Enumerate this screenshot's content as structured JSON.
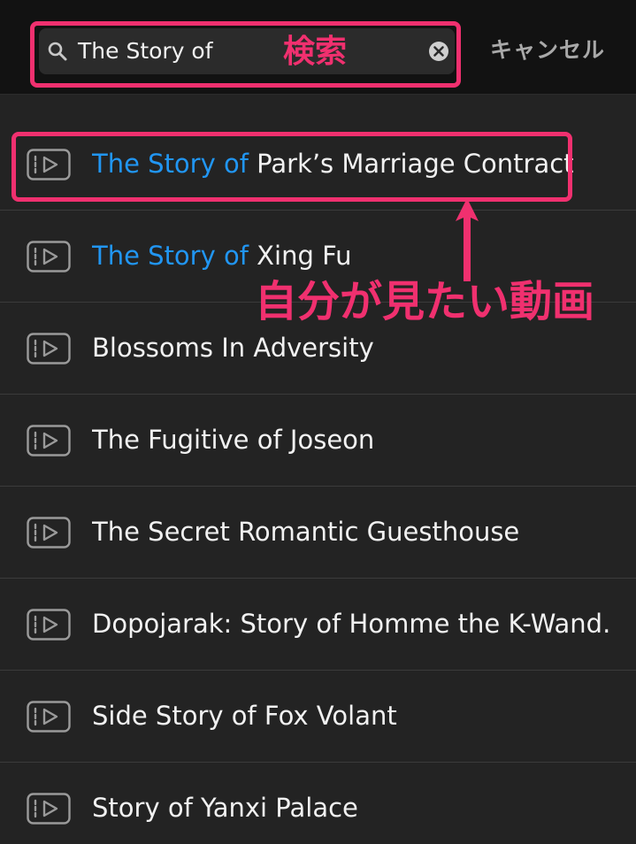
{
  "search": {
    "query": "The Story of",
    "cancel_label": "キャンセル"
  },
  "results": [
    {
      "highlight": "The Story of",
      "rest": " Park’s Marriage Contract"
    },
    {
      "highlight": "The Story of",
      "rest": " Xing Fu"
    },
    {
      "highlight": "",
      "rest": "Blossoms In Adversity"
    },
    {
      "highlight": "",
      "rest": "The Fugitive of Joseon"
    },
    {
      "highlight": "",
      "rest": "The Secret Romantic Guesthouse"
    },
    {
      "highlight": "",
      "rest": "Dopojarak: Story of Homme the K-Wand..."
    },
    {
      "highlight": "",
      "rest": "Side Story of Fox Volant"
    },
    {
      "highlight": "",
      "rest": "Story of Yanxi Palace"
    }
  ],
  "annotations": {
    "search_label": "検索",
    "target_label": "自分が見たい動画",
    "color": "#f0306f"
  },
  "colors": {
    "highlight": "#2196f3",
    "background": "#232323",
    "topbar": "#121212"
  },
  "icons": {
    "search": "search-icon",
    "clear": "clear-icon",
    "video": "video-icon"
  }
}
